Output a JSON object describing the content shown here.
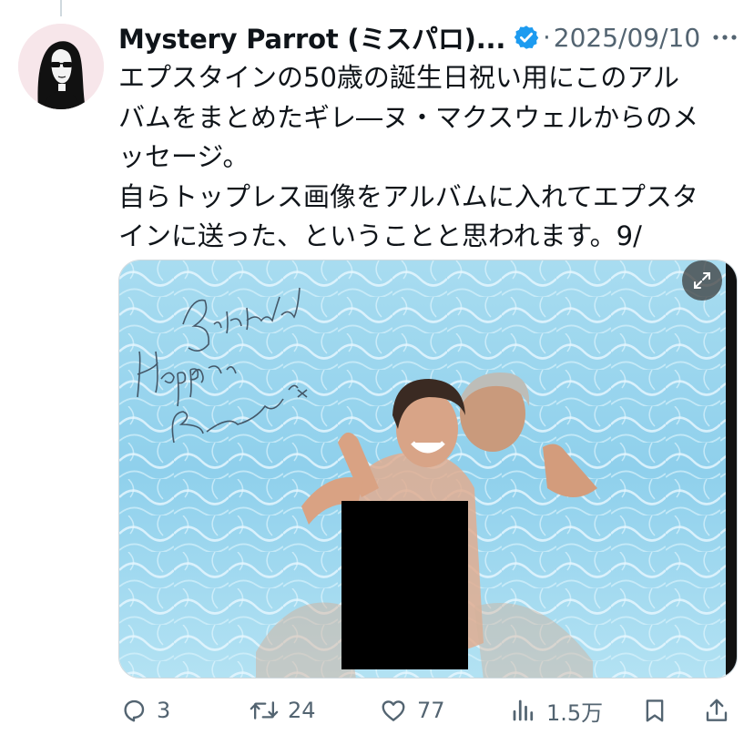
{
  "tweet": {
    "author": {
      "display_name": "Mystery Parrot (ミスパロ)...",
      "avatar_icon": "avatar-woman-sunglasses-icon",
      "verified_icon": "verified-badge-icon",
      "verified_color": "#1d9bf0"
    },
    "separator": "·",
    "timestamp": "2025/09/10",
    "text_lines": [
      "エプスタインの50歳の誕生日祝い用にこのアル",
      "バムをまとめたギレ―ヌ・マクスウェルからのメ",
      "ッセージ。",
      "自らトップレス画像をアルバムに入れてエプスタ",
      "インに送った、ということと思われます。9/"
    ],
    "media": {
      "handwriting": "Happy Birthday / Love / signature",
      "expand_icon": "expand-icon",
      "censor_color": "#000000"
    },
    "actions": {
      "reply": {
        "icon": "reply-icon",
        "count": "3"
      },
      "retweet": {
        "icon": "retweet-icon",
        "count": "24"
      },
      "like": {
        "icon": "heart-icon",
        "count": "77"
      },
      "views": {
        "icon": "views-chart-icon",
        "count": "1.5万"
      },
      "bookmark": {
        "icon": "bookmark-icon"
      },
      "share": {
        "icon": "share-icon"
      }
    },
    "colors": {
      "secondary_text": "#536471",
      "text": "#0f1419"
    }
  }
}
